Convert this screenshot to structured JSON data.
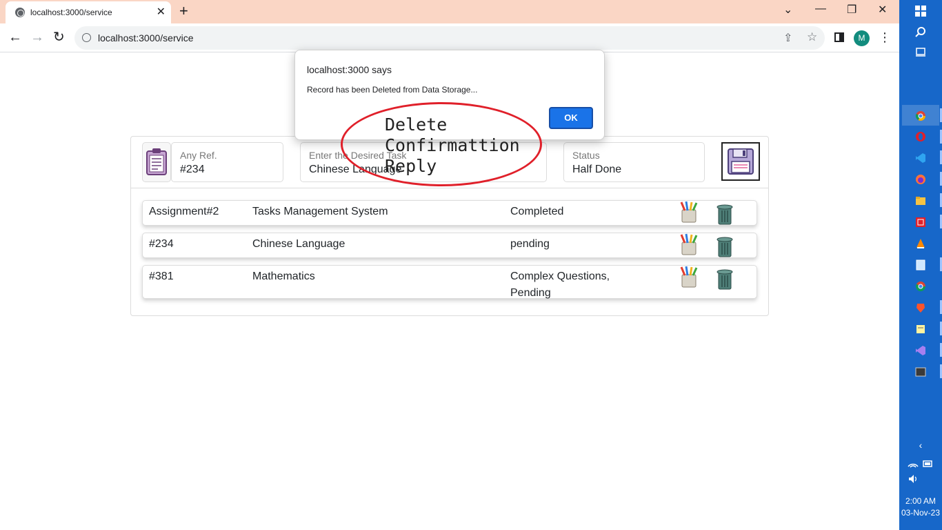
{
  "browser": {
    "tab_title": "localhost:3000/service",
    "url": "localhost:3000/service",
    "profile_initial": "M"
  },
  "taskbar": {
    "time": "2:00 AM",
    "date": "03-Nov-23"
  },
  "form": {
    "ref_label": "Any Ref.",
    "ref_value": "#234",
    "task_label": "Enter the Desired Task",
    "task_value": "Chinese Language",
    "status_label": "Status",
    "status_value": "Half Done"
  },
  "records": [
    {
      "ref": "Assignment#2",
      "task": "Tasks Management System",
      "status": "Completed"
    },
    {
      "ref": "#234",
      "task": "Chinese Language",
      "status": "pending"
    },
    {
      "ref": "#381",
      "task": "Mathematics",
      "status": "Complex Questions, Pending"
    }
  ],
  "dialog": {
    "title": "localhost:3000 says",
    "message": "Record has been Deleted from Data Storage...",
    "ok_label": "OK"
  },
  "annotation": {
    "text": "Delete\nConfirmattion\nReply",
    "color": "#e0202a"
  },
  "icons": {
    "tab": "globe-icon",
    "edit": "pencil-cup-icon",
    "delete": "trash-can-icon",
    "save": "floppy-disk-icon",
    "clipboard": "clipboard-icon"
  }
}
